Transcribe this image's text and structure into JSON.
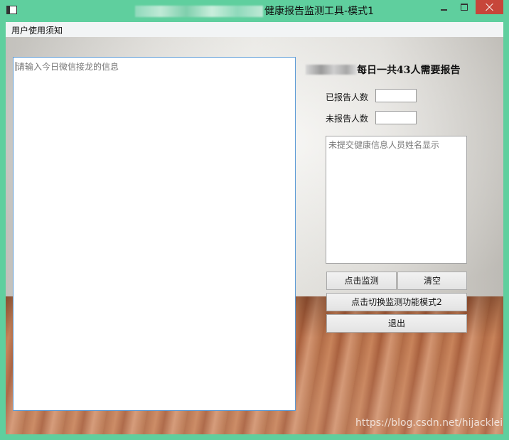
{
  "window": {
    "title": "健康报告监测工具-模式1"
  },
  "menu": {
    "items": [
      "用户使用须知"
    ]
  },
  "left_textarea": {
    "placeholder": "请输入今日微信接龙的信息"
  },
  "summary": {
    "heading": "每日一共43人需要报告"
  },
  "fields": {
    "reported_label": "已报告人数",
    "reported_value": "",
    "unreported_label": "未报告人数",
    "unreported_value": ""
  },
  "names_box": {
    "placeholder": "未提交健康信息人员姓名显示"
  },
  "buttons": {
    "monitor": "点击监测",
    "clear": "清空",
    "switch_mode": "点击切换监测功能模式2",
    "exit": "退出"
  },
  "watermark": "https://blog.csdn.net/hijacklei",
  "colors": {
    "frame": "#5fcf9e",
    "close_button": "#c7463a",
    "textarea_focus_border": "#5c9bd6"
  }
}
